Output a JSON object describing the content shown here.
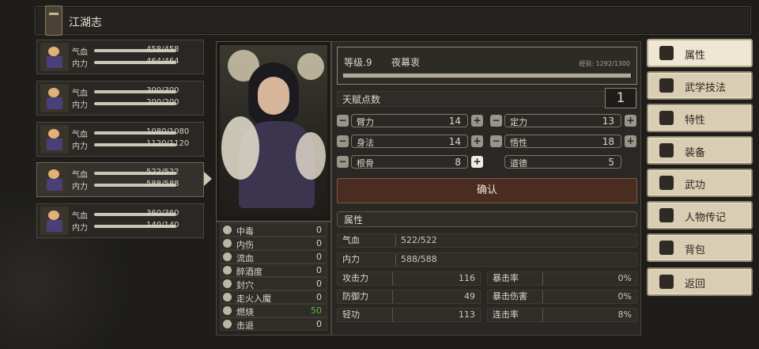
{
  "title": "江湖志",
  "characters": [
    {
      "hp_label": "气血",
      "hp": "458/458",
      "mp_label": "内力",
      "mp": "464/464"
    },
    {
      "hp_label": "气血",
      "hp": "300/300",
      "mp_label": "内力",
      "mp": "200/200"
    },
    {
      "hp_label": "气血",
      "hp": "1080/1080",
      "mp_label": "内力",
      "mp": "1120/1120"
    },
    {
      "hp_label": "气血",
      "hp": "522/522",
      "mp_label": "内力",
      "mp": "588/588"
    },
    {
      "hp_label": "气血",
      "hp": "360/360",
      "mp_label": "内力",
      "mp": "140/140"
    }
  ],
  "level": {
    "label": "等级.9",
    "name": "夜幕衷",
    "exp": "经验: 1292/1300",
    "exp_fraction": 0.994
  },
  "talent": {
    "label": "天赋点数",
    "value": "1"
  },
  "attributes": [
    {
      "name": "臂力",
      "value": "14"
    },
    {
      "name": "定力",
      "value": "13"
    },
    {
      "name": "身法",
      "value": "14"
    },
    {
      "name": "悟性",
      "value": "18"
    },
    {
      "name": "根骨",
      "value": "8"
    },
    {
      "name": "道德",
      "value": "5"
    }
  ],
  "confirm_label": "确认",
  "props_title": "属性",
  "props": [
    {
      "name": "气血",
      "value": "522/522"
    },
    {
      "name": "内力",
      "value": "588/588"
    }
  ],
  "combat": [
    {
      "name": "攻击力",
      "value": "116",
      "name2": "暴击率",
      "value2": "0%"
    },
    {
      "name": "防御力",
      "value": "49",
      "name2": "暴击伤害",
      "value2": "0%"
    },
    {
      "name": "轻功",
      "value": "113",
      "name2": "连击率",
      "value2": "8%"
    }
  ],
  "status": [
    {
      "name": "中毒",
      "value": "0",
      "icon": "poison-icon"
    },
    {
      "name": "内伤",
      "value": "0",
      "icon": "broken-heart-icon"
    },
    {
      "name": "流血",
      "value": "0",
      "icon": "blood-icon"
    },
    {
      "name": "醉酒度",
      "value": "0",
      "icon": "wine-icon"
    },
    {
      "name": "封穴",
      "value": "0",
      "icon": "acupoint-icon"
    },
    {
      "name": "走火入魔",
      "value": "0",
      "icon": "spiral-icon"
    },
    {
      "name": "燃烧",
      "value": "50",
      "icon": "fire-icon"
    },
    {
      "name": "击退",
      "value": "0",
      "icon": "boot-icon"
    }
  ],
  "menu": [
    {
      "label": "属性",
      "icon": "person-icon"
    },
    {
      "label": "武学技法",
      "icon": "martial-icon"
    },
    {
      "label": "特性",
      "icon": "trait-icon"
    },
    {
      "label": "装备",
      "icon": "sword-icon"
    },
    {
      "label": "武功",
      "icon": "scroll-icon"
    },
    {
      "label": "人物传记",
      "icon": "book-icon"
    },
    {
      "label": "背包",
      "icon": "bag-icon"
    },
    {
      "label": "返回",
      "icon": "door-icon"
    }
  ],
  "accent": {
    "burn_value": "#61b93b",
    "confirm_bg": "#4a2d20"
  }
}
